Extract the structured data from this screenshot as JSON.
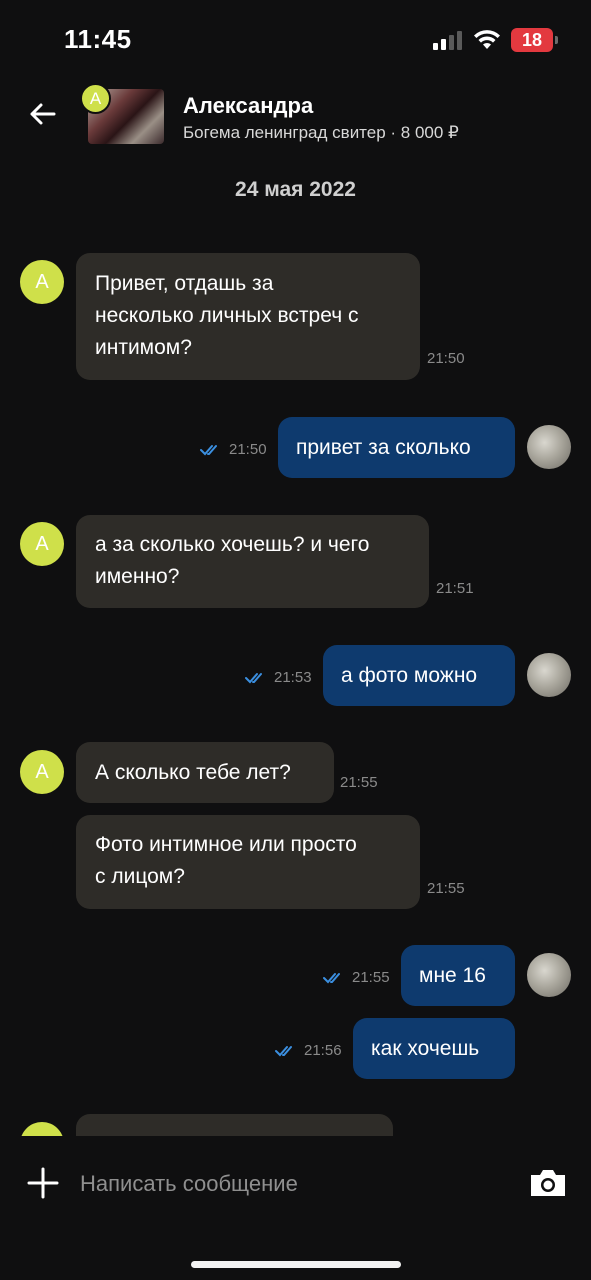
{
  "status_bar": {
    "time": "11:45",
    "battery": "18"
  },
  "header": {
    "contact_name": "Александра",
    "avatar_letter": "А",
    "listing": "Богема ленинград свитер · 8 000 ₽"
  },
  "date_separator": "24 мая 2022",
  "messages": [
    {
      "direction": "in",
      "text": "Привет, отдашь за\nнесколько личных встреч с\nинтимом?",
      "time": "21:50"
    },
    {
      "direction": "out",
      "text": "привет за сколько",
      "time": "21:50"
    },
    {
      "direction": "in",
      "text": "а за сколько хочешь? и чего\nименно?",
      "time": "21:51"
    },
    {
      "direction": "out",
      "text": "а фото можно",
      "time": "21:53"
    },
    {
      "direction": "in",
      "text": "А сколько тебе лет?",
      "time": "21:55"
    },
    {
      "direction": "in",
      "text": "Фото интимное или просто\nс лицом?",
      "time": "21:55"
    },
    {
      "direction": "out",
      "text": "мне 16",
      "time": "21:55"
    },
    {
      "direction": "out",
      "text": "как хочешь",
      "time": "21:56"
    }
  ],
  "composer": {
    "placeholder": "Написать сообщение"
  },
  "colors": {
    "incoming_bubble": "#2e2c28",
    "outgoing_bubble": "#0e3a6e",
    "avatar_bg": "#cfe04a",
    "read_ticks": "#3b8fe0"
  }
}
